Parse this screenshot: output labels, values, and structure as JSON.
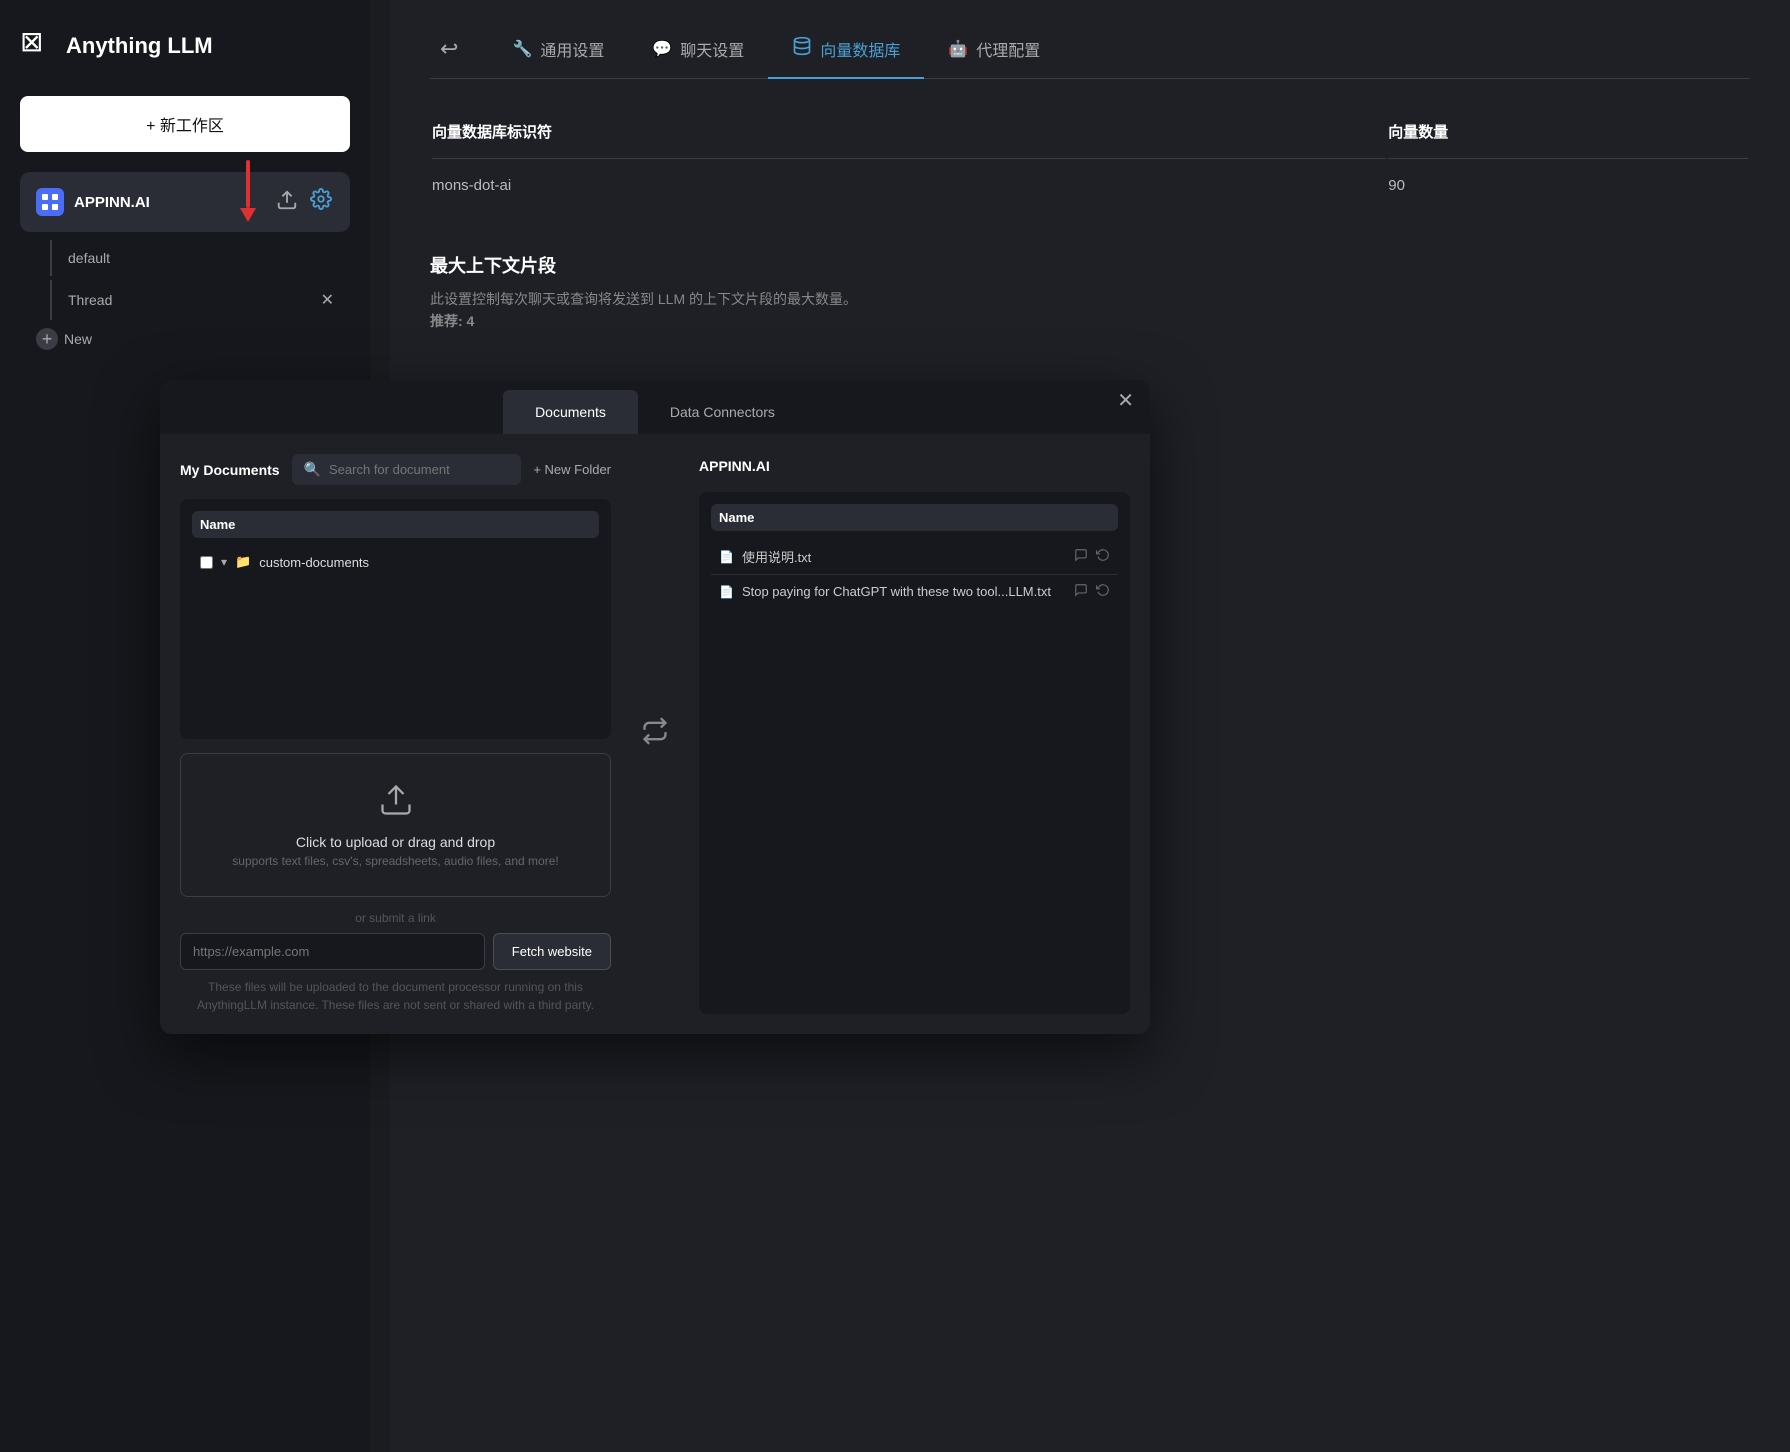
{
  "app": {
    "title": "Anything LLM",
    "logo_symbol": "⊠"
  },
  "sidebar": {
    "new_workspace_label": "+ 新工作区",
    "workspace": {
      "name": "APPINN.AI",
      "default_thread": "default",
      "thread_label": "Thread",
      "new_thread_label": "New"
    }
  },
  "settings": {
    "back_icon": "↩",
    "tabs": [
      {
        "id": "general",
        "label": "通用设置",
        "icon": "🔧",
        "active": false
      },
      {
        "id": "chat",
        "label": "聊天设置",
        "icon": "💬",
        "active": false
      },
      {
        "id": "vector",
        "label": "向量数据库",
        "icon": "🗄",
        "active": true
      },
      {
        "id": "agent",
        "label": "代理配置",
        "icon": "🤖",
        "active": false
      }
    ],
    "vector_table": {
      "col1": "向量数据库标识符",
      "col2": "向量数量",
      "row_identifier": "mons-dot-ai",
      "row_count": "90"
    },
    "context": {
      "title": "最大上下文片段",
      "desc": "此设置控制每次聊天或查询将发送到 LLM 的上下文片段的最大数量。",
      "recommendation": "推荐: 4"
    }
  },
  "modal": {
    "tabs": [
      {
        "id": "documents",
        "label": "Documents",
        "active": true
      },
      {
        "id": "data_connectors",
        "label": "Data Connectors",
        "active": false
      }
    ],
    "close_icon": "✕",
    "left": {
      "my_docs_label": "My Documents",
      "search_placeholder": "Search for document",
      "new_folder_label": "+ New Folder",
      "file_header": "Name",
      "folder_name": "custom-documents"
    },
    "transfer_icon": "⇄",
    "right": {
      "workspace_name": "APPINN.AI",
      "file_header": "Name",
      "files": [
        {
          "name": "使用说明.txt",
          "has_actions": true
        },
        {
          "name": "Stop paying for ChatGPT with these two tool...LLM.txt",
          "has_actions": true
        }
      ]
    },
    "upload": {
      "icon": "⬆",
      "title": "Click to upload or drag and drop",
      "subtitle": "supports text files, csv's, spreadsheets, audio files, and more!"
    },
    "url": {
      "divider_text": "or submit a link",
      "placeholder": "https://example.com",
      "fetch_button_label": "Fetch website"
    },
    "disclaimer": "These files will be uploaded to the document processor running on this AnythingLLM instance.\nThese files are not sent or shared with a third party."
  },
  "colors": {
    "accent_blue": "#4a9fd4",
    "brand_blue": "#4a6cf7",
    "arrow_red": "#e03030",
    "bg_dark": "#1a1c20",
    "bg_panel": "#1e2026",
    "bg_sidebar": "#16181d",
    "bg_card": "#2a2d35"
  }
}
